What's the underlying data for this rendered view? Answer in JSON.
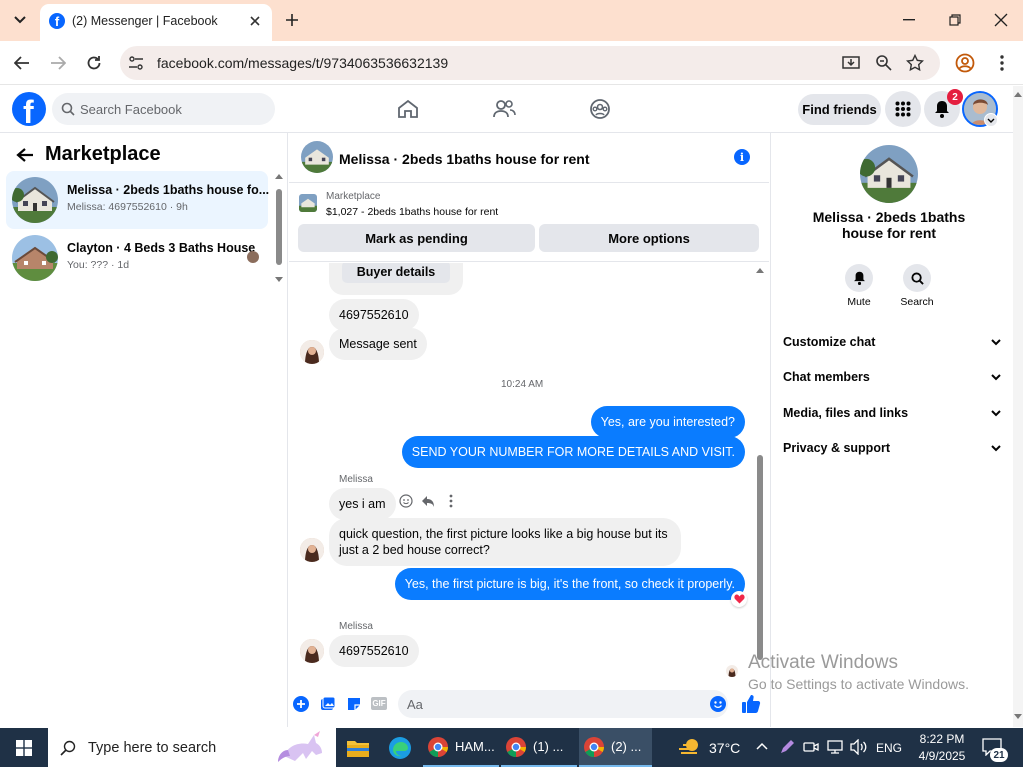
{
  "browser": {
    "tab_title": "(2) Messenger | Facebook",
    "url": "facebook.com/messages/t/9734063536632139"
  },
  "fb": {
    "search_placeholder": "Search Facebook",
    "find_friends": "Find friends",
    "notif_count": "2",
    "brand_color": "#0866ff"
  },
  "left": {
    "title": "Marketplace",
    "conversations": [
      {
        "name": "Melissa · 2beds 1baths house fo...",
        "preview": "Melissa: 4697552610 · 9h"
      },
      {
        "name": "Clayton · 4 Beds 3 Baths House",
        "preview": "You: ??? · 1d"
      }
    ]
  },
  "chat": {
    "title": "Melissa · 2beds 1baths house for rent",
    "listing_label": "Marketplace",
    "listing_price": "$1,027 - 2beds 1baths house for rent",
    "mark_pending": "Mark as pending",
    "more_options": "More options",
    "buyer_details": "Buyer details",
    "timestamp": "10:24 AM",
    "sender_name": "Melissa",
    "messages": {
      "m1": "4697552610",
      "m2": "Message sent",
      "m3": "Yes, are you interested?",
      "m4": "SEND YOUR NUMBER FOR MORE DETAILS AND VISIT.",
      "m5": "yes i am",
      "m6": "quick question, the first picture looks like a big house but its just a 2 bed house correct?",
      "m7": "Yes, the first picture is big, it's the front, so check it properly.",
      "m8": "4697552610"
    },
    "composer_placeholder": "Aa",
    "bubble_color": "#0a7cff"
  },
  "right": {
    "title": "Melissa · 2beds 1baths house for rent",
    "mute": "Mute",
    "search": "Search",
    "menu": [
      "Customize chat",
      "Chat members",
      "Media, files and links",
      "Privacy & support"
    ]
  },
  "watermark": {
    "line1": "Activate Windows",
    "line2": "Go to Settings to activate Windows."
  },
  "taskbar": {
    "search_placeholder": "Type here to search",
    "app1": "HAM...",
    "app2": "(1) ...",
    "app3": "(2) ...",
    "weather": "37°C",
    "lang": "ENG",
    "time": "8:22 PM",
    "date": "4/9/2025",
    "notif": "21"
  }
}
